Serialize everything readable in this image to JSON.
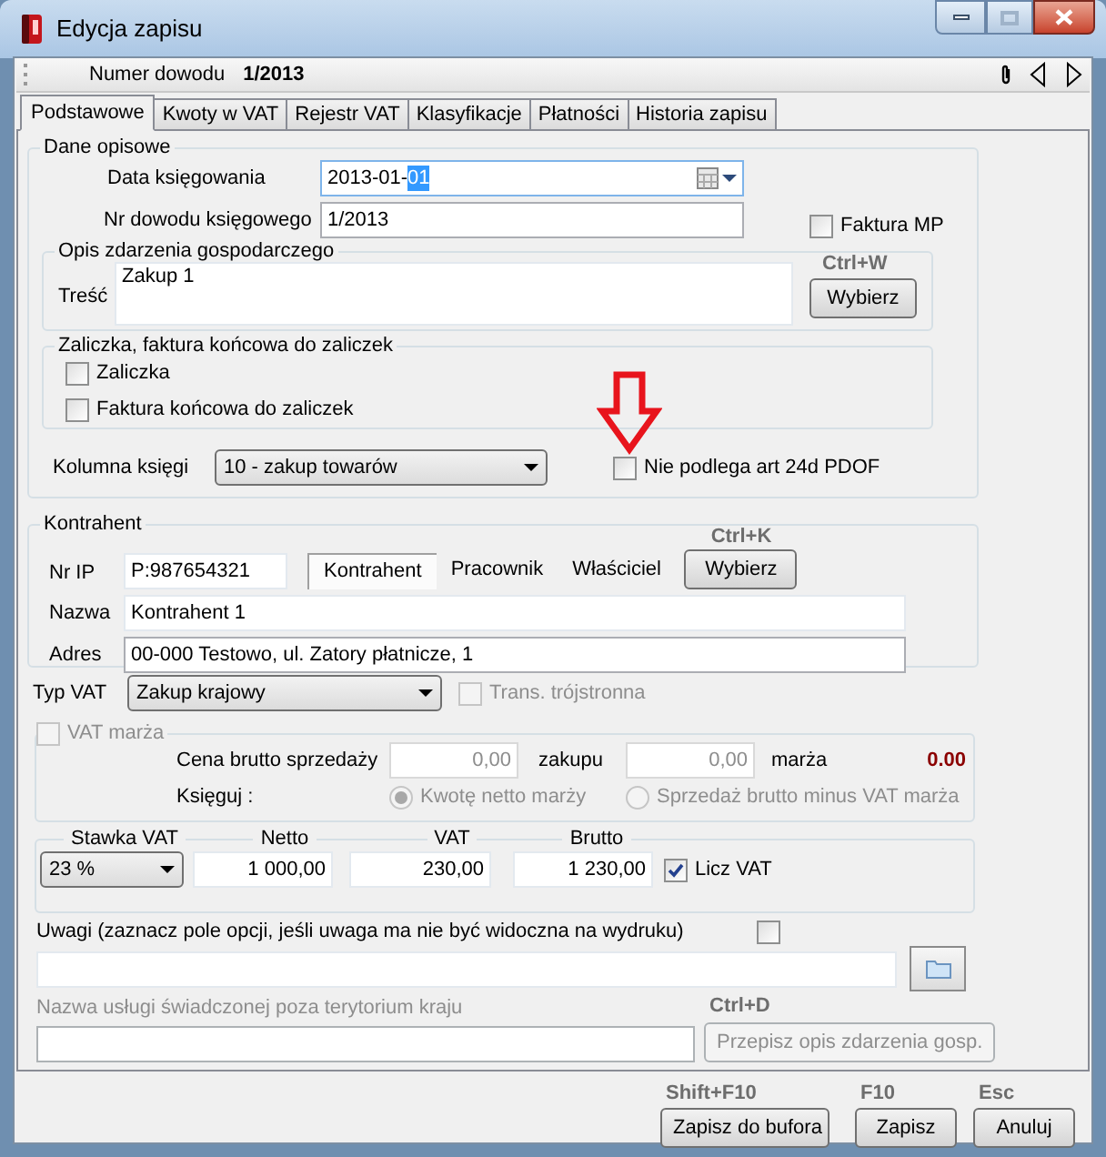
{
  "window": {
    "title": "Edycja zapisu"
  },
  "header": {
    "label": "Numer dowodu",
    "value": "1/2013"
  },
  "tabs": [
    {
      "label": "Podstawowe",
      "selected": true
    },
    {
      "label": "Kwoty w VAT",
      "selected": false
    },
    {
      "label": "Rejestr VAT",
      "selected": false
    },
    {
      "label": "Klasyfikacje",
      "selected": false
    },
    {
      "label": "Płatności",
      "selected": false
    },
    {
      "label": "Historia zapisu",
      "selected": false
    }
  ],
  "dane_opisowe": {
    "title": "Dane opisowe",
    "data_ksiegowania": {
      "label": "Data księgowania",
      "value": "2013-01-",
      "highlighted": "01"
    },
    "nr_dowodu": {
      "label": "Nr dowodu księgowego",
      "value": "1/2013"
    },
    "faktura_mp": {
      "label": "Faktura MP",
      "checked": false
    },
    "opis": {
      "title": "Opis zdarzenia gospodarczego",
      "label": "Treść",
      "value": "Zakup 1",
      "shortcut": "Ctrl+W",
      "button": "Wybierz"
    },
    "zaliczki": {
      "title": "Zaliczka, faktura końcowa do zaliczek",
      "options": [
        {
          "label": "Zaliczka",
          "checked": false
        },
        {
          "label": "Faktura końcowa do zaliczek",
          "checked": false
        }
      ]
    },
    "kolumna": {
      "label": "Kolumna księgi",
      "value": "10 - zakup towarów"
    },
    "nie_podlega": {
      "label": "Nie podlega art 24d PDOF",
      "checked": false
    }
  },
  "kontrahent": {
    "title": "Kontrahent",
    "nr_ip": {
      "label": "Nr IP",
      "value": "P:987654321"
    },
    "types": [
      {
        "label": "Kontrahent",
        "selected": true
      },
      {
        "label": "Pracownik",
        "selected": false
      },
      {
        "label": "Właściciel",
        "selected": false
      }
    ],
    "shortcut": "Ctrl+K",
    "button": "Wybierz",
    "nazwa": {
      "label": "Nazwa",
      "value": "Kontrahent 1"
    },
    "adres": {
      "label": "Adres",
      "value": "00-000 Testowo, ul. Zatory płatnicze, 1"
    }
  },
  "typ_vat": {
    "label": "Typ VAT",
    "value": "Zakup krajowy"
  },
  "trans_trojstronna": {
    "label": "Trans. trójstronna",
    "checked": false,
    "disabled": true
  },
  "vat_marza": {
    "label": "VAT marża",
    "checked": false,
    "disabled": true,
    "cena_label": "Cena brutto sprzedaży",
    "sprzedazy": "0,00",
    "zakupu_label": "zakupu",
    "zakupu": "0,00",
    "marza_label": "marża",
    "marza": "0.00",
    "ksieguj_label": "Księguj :",
    "options": [
      {
        "label": "Kwotę netto marży",
        "selected": true
      },
      {
        "label": "Sprzedaż brutto minus VAT marża",
        "selected": false
      }
    ]
  },
  "stawka": {
    "columns": [
      "Stawka VAT",
      "Netto",
      "VAT",
      "Brutto"
    ],
    "rate": "23 %",
    "netto": "1 000,00",
    "vat": "230,00",
    "brutto": "1 230,00",
    "licz_vat": {
      "label": "Licz VAT",
      "checked": true
    }
  },
  "uwagi": {
    "label": "Uwagi  (zaznacz pole opcji, jeśli uwaga ma nie być widoczna na wydruku)",
    "checked": false
  },
  "usluga": {
    "label": "Nazwa usługi świadczonej poza terytorium kraju",
    "disabled": true,
    "shortcut": "Ctrl+D",
    "button": "Przepisz opis zdarzenia gosp."
  },
  "footer": [
    {
      "shortcut": "Shift+F10",
      "label": "Zapisz do bufora"
    },
    {
      "shortcut": "F10",
      "label": "Zapisz"
    },
    {
      "shortcut": "Esc",
      "label": "Anuluj"
    }
  ]
}
